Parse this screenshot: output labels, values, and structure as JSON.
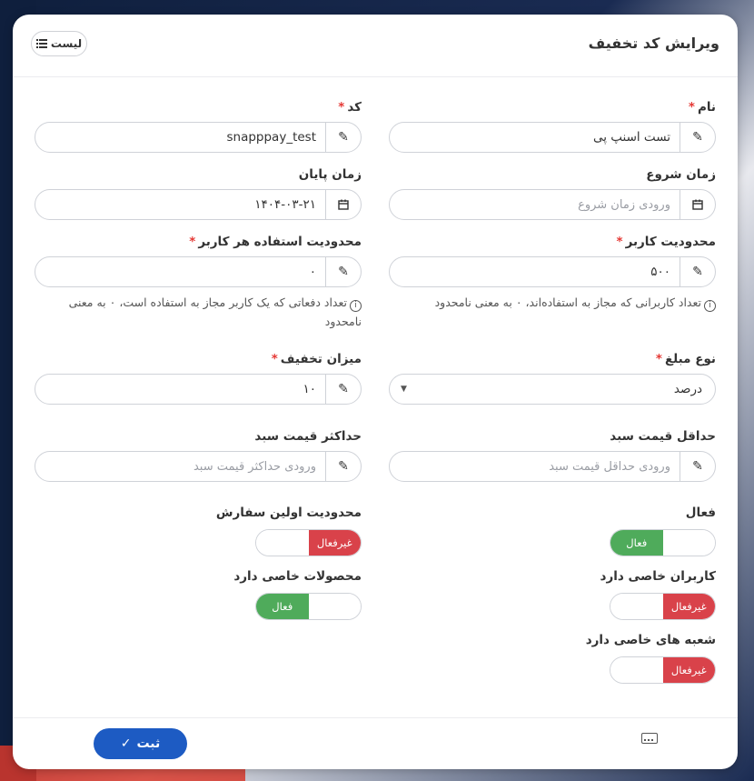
{
  "header": {
    "title": "ویرایش کد تخفیف",
    "list_label": "لیست"
  },
  "fields": {
    "name": {
      "label": "نام",
      "required": "*",
      "value": "تست اسنپ پی"
    },
    "code": {
      "label": "کد",
      "required": "*",
      "value": "snapppay_test"
    },
    "start_time": {
      "label": "زمان شروع",
      "placeholder": "ورودی زمان شروع"
    },
    "end_time": {
      "label": "زمان پایان",
      "value": "۱۴۰۴-۰۳-۲۱"
    },
    "user_limit": {
      "label": "محدودیت کاربر",
      "required": "*",
      "value": "۵۰۰",
      "hint": "تعداد کاربرانی که مجاز به استفاده‌اند، ۰ به معنی نامحدود"
    },
    "per_user_limit": {
      "label": "محدودیت استفاده هر کاربر",
      "required": "*",
      "value": "۰",
      "hint": "تعداد دفعاتی که یک کاربر مجاز به استفاده است، ۰ به معنی نامحدود"
    },
    "amount_type": {
      "label": "نوع مبلغ",
      "required": "*",
      "value": "درصد"
    },
    "discount_amount": {
      "label": "میزان تخفیف",
      "required": "*",
      "value": "۱۰"
    },
    "min_cart": {
      "label": "حداقل قیمت سبد",
      "placeholder": "ورودی حداقل قیمت سبد"
    },
    "max_cart": {
      "label": "حداکثر قیمت سبد",
      "placeholder": "ورودی حداکثر قیمت سبد"
    }
  },
  "toggles": {
    "active": {
      "label": "فعال",
      "state": "فعال"
    },
    "first_order": {
      "label": "محدودیت اولین سفارش",
      "state": "غیرفعال"
    },
    "special_users": {
      "label": "کاربران خاصی دارد",
      "state": "غیرفعال"
    },
    "special_products": {
      "label": "محصولات خاصی دارد",
      "state": "فعال"
    },
    "special_branches": {
      "label": "شعبه های خاصی دارد",
      "state": "غیرفعال"
    }
  },
  "footer": {
    "submit_label": "ثبت"
  },
  "colors": {
    "accent": "#1d5bc3",
    "on": "#4fab5b",
    "off": "#d9424a",
    "required": "#e53935"
  },
  "icons": [
    "list-icon",
    "pencil-icon",
    "calendar-icon",
    "info-icon",
    "caret-down-icon",
    "check-icon",
    "keyboard-icon"
  ]
}
